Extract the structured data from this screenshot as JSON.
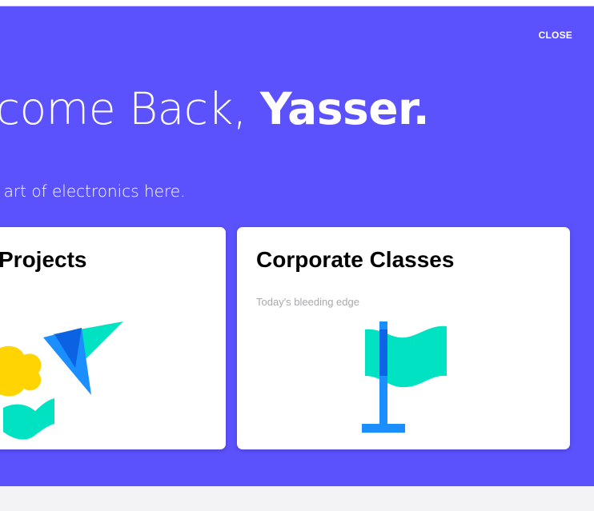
{
  "header": {
    "close_label": "CLOSE",
    "welcome_prefix": "lcome Back, ",
    "welcome_name": "Yasser.",
    "subtitle": "e art of electronics here."
  },
  "cards": [
    {
      "title": "Projects",
      "subtitle": ""
    },
    {
      "title": "Corporate Classes",
      "subtitle": "Today's bleeding edge"
    }
  ],
  "colors": {
    "hero_background": "#5b52fe",
    "teal": "#00e2c1",
    "blue": "#1b8fff",
    "dark_blue": "#0a5ee0",
    "yellow": "#ffd400"
  },
  "icons": {
    "projects": "abstract-shapes-illustration",
    "classes": "flag-illustration"
  }
}
